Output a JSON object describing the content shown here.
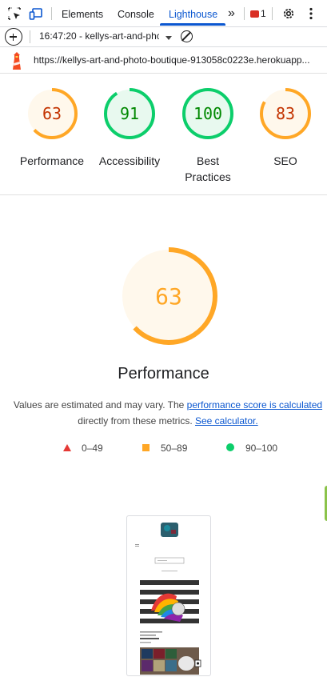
{
  "tabs": {
    "elements": "Elements",
    "console": "Console",
    "lighthouse": "Lighthouse",
    "more": "»",
    "issues_count": "1"
  },
  "toolbar": {
    "report": "16:47:20 - kellys-art-and-phc"
  },
  "url": "https://kellys-art-and-photo-boutique-913058c0223e.herokuapp...",
  "scores": [
    {
      "label": "Performance",
      "value": "63",
      "color": "#fa3"
    },
    {
      "label": "Accessibility",
      "value": "91",
      "color": "#0cce6b"
    },
    {
      "label": "Best Practices",
      "value": "100",
      "color": "#0cce6b"
    },
    {
      "label": "SEO",
      "value": "83",
      "color": "#fa3"
    }
  ],
  "main": {
    "score": "63",
    "title": "Performance",
    "desc_part1": "Values are estimated and may vary. The ",
    "desc_link1": "performance score is calculated",
    "desc_part2": "directly from these metrics. ",
    "desc_link2": "See calculator."
  },
  "legend": {
    "fail": "0–49",
    "average": "50–89",
    "pass": "90–100"
  },
  "thumbnail": {
    "caption": "Kelly's Art"
  }
}
